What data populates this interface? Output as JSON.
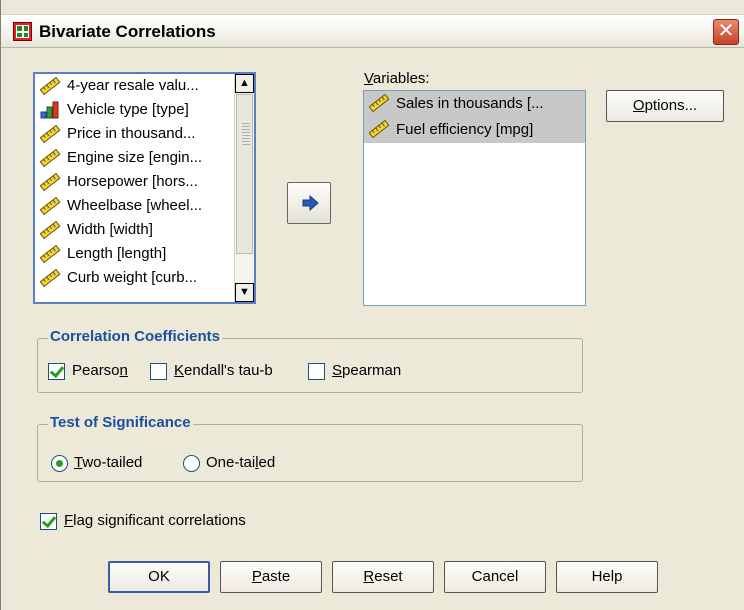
{
  "window": {
    "title": "Bivariate Correlations",
    "close_glyph": "✕"
  },
  "source_list": {
    "items": [
      {
        "label": "4-year resale valu...",
        "icon": "scale-ruler-icon"
      },
      {
        "label": "Vehicle type [type]",
        "icon": "bar-chart-nominal-icon"
      },
      {
        "label": "Price in thousand...",
        "icon": "scale-ruler-icon"
      },
      {
        "label": "Engine size [engin...",
        "icon": "scale-ruler-icon"
      },
      {
        "label": "Horsepower [hors...",
        "icon": "scale-ruler-icon"
      },
      {
        "label": "Wheelbase [wheel...",
        "icon": "scale-ruler-icon"
      },
      {
        "label": "Width [width]",
        "icon": "scale-ruler-icon"
      },
      {
        "label": "Length [length]",
        "icon": "scale-ruler-icon"
      },
      {
        "label": "Curb weight [curb...",
        "icon": "scale-ruler-icon"
      }
    ]
  },
  "variables": {
    "label_underlined": "V",
    "label_rest": "ariables:",
    "items": [
      {
        "label": "Sales in thousands [...",
        "icon": "scale-ruler-icon"
      },
      {
        "label": "Fuel efficiency [mpg]",
        "icon": "scale-ruler-icon"
      }
    ]
  },
  "buttons": {
    "options_underlined": "O",
    "options_rest": "ptions...",
    "ok": "OK",
    "paste_underlined": "P",
    "paste_rest": "aste",
    "reset_underlined": "R",
    "reset_rest": "eset",
    "cancel": "Cancel",
    "help": "Help"
  },
  "correlation_coefficients": {
    "legend": "Correlation Coefficients",
    "pearson": {
      "pre": "Pearso",
      "u": "n",
      "post": "",
      "checked": true
    },
    "kendall": {
      "pre": "",
      "u": "K",
      "post": "endall's tau-b",
      "checked": false
    },
    "spearman": {
      "pre": "",
      "u": "S",
      "post": "pearman",
      "checked": false
    }
  },
  "test_of_significance": {
    "legend": "Test of Significance",
    "two_tailed": {
      "pre": "",
      "u": "T",
      "post": "wo-tailed",
      "selected": true
    },
    "one_tailed": {
      "pre": "One-tai",
      "u": "l",
      "post": "ed",
      "selected": false
    }
  },
  "flag": {
    "pre": "",
    "u": "F",
    "post": "lag significant correlations",
    "checked": true
  },
  "colors": {
    "dialog_bg": "#ece9d8",
    "group_legend": "#1c4f9c",
    "check_mark": "#21a121",
    "list_border": "#5a7ec2",
    "selected_item_bg": "#c8c8c8"
  }
}
